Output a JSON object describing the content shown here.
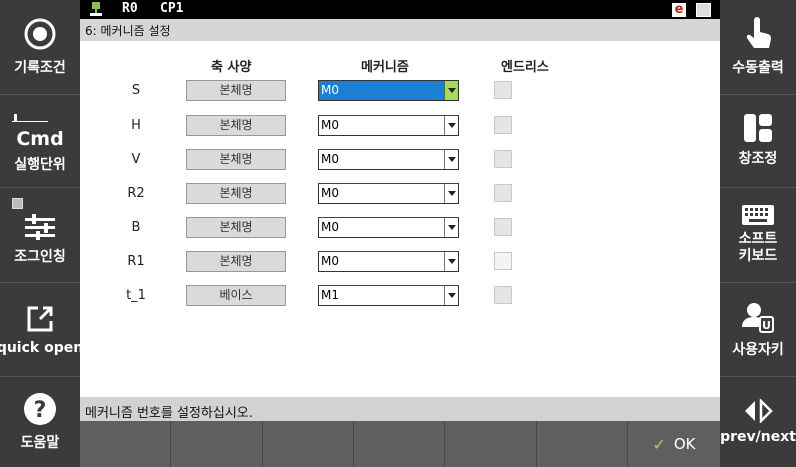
{
  "status_bar": {
    "robot": "R0",
    "controller": "CP1",
    "mode_badge": "e"
  },
  "title": "6: 메커니즘 설정",
  "left_panel": [
    {
      "label": "기록조건",
      "icon": "record-circle-icon"
    },
    {
      "label": "실행단위",
      "icon_text": "Cmd",
      "icon": "cmd-icon"
    },
    {
      "label": "조그인칭",
      "icon": "sliders-icon"
    },
    {
      "label": "quick open",
      "icon": "external-link-icon"
    },
    {
      "label": "도움말",
      "icon": "help-icon"
    }
  ],
  "right_panel": [
    {
      "label": "수동출력",
      "icon": "hand-pointer-icon"
    },
    {
      "label": "창조정",
      "icon": "window-layout-icon"
    },
    {
      "label1": "소프트",
      "label2": "키보드",
      "icon": "keyboard-icon"
    },
    {
      "label": "사용자키",
      "icon": "user-key-icon"
    },
    {
      "label": "prev/next",
      "icon": "prev-next-icon"
    }
  ],
  "table": {
    "headers": {
      "axis_spec": "축 사양",
      "mechanism": "메커니즘",
      "endless": "엔드리스"
    },
    "rows": [
      {
        "axis": "S",
        "spec": "본체명",
        "mechanism": "M0"
      },
      {
        "axis": "H",
        "spec": "본체명",
        "mechanism": "M0"
      },
      {
        "axis": "V",
        "spec": "본체명",
        "mechanism": "M0"
      },
      {
        "axis": "R2",
        "spec": "본체명",
        "mechanism": "M0"
      },
      {
        "axis": "B",
        "spec": "본체명",
        "mechanism": "M0"
      },
      {
        "axis": "R1",
        "spec": "본체명",
        "mechanism": "M0"
      },
      {
        "axis": "t_1",
        "spec": "베이스",
        "mechanism": "M1"
      }
    ]
  },
  "message": "메커니즘 번호를 설정하십시오.",
  "ok_label": "OK"
}
